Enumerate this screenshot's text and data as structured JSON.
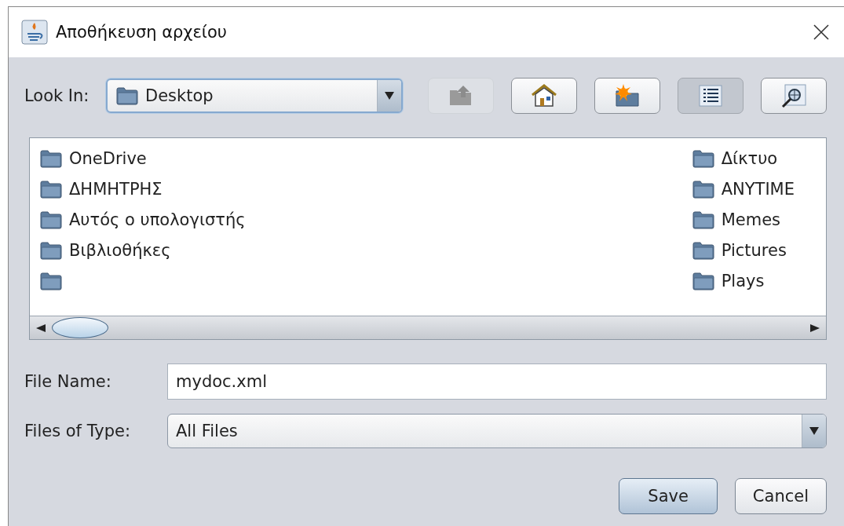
{
  "window": {
    "title": "Αποθήκευση αρχείου"
  },
  "look_in": {
    "label": "Look In:",
    "value": "Desktop"
  },
  "toolbar": [
    {
      "kind": "up",
      "disabled": true,
      "selected": false
    },
    {
      "kind": "home",
      "disabled": false,
      "selected": false
    },
    {
      "kind": "new_folder",
      "disabled": false,
      "selected": false
    },
    {
      "kind": "list",
      "disabled": false,
      "selected": true
    },
    {
      "kind": "details",
      "disabled": false,
      "selected": false
    }
  ],
  "file_list": {
    "columns": [
      {
        "items": [
          {
            "kind": "folder",
            "name": "OneDrive"
          },
          {
            "kind": "folder",
            "name": "ΔΗΜΗΤΡΗΣ"
          },
          {
            "kind": "folder",
            "name": "Αυτός ο υπολογιστής"
          },
          {
            "kind": "folder",
            "name": "Βιβλιοθήκες"
          },
          {
            "kind": "folder"
          }
        ]
      },
      {
        "items": [
          {
            "kind": "folder",
            "name": "Δίκτυο"
          },
          {
            "kind": "folder",
            "name": "ANYTIME"
          },
          {
            "kind": "folder",
            "name": "Memes"
          },
          {
            "kind": "folder",
            "name": "Pictures"
          },
          {
            "kind": "folder",
            "name": "Plays"
          }
        ]
      }
    ]
  },
  "file_name": {
    "label": "File Name:",
    "value": "mydoc.xml"
  },
  "file_type": {
    "label": "Files of Type:",
    "value": "All Files"
  },
  "buttons": [
    {
      "label": "Save",
      "kind": "default"
    },
    {
      "label": "Cancel",
      "kind": "normal"
    }
  ]
}
